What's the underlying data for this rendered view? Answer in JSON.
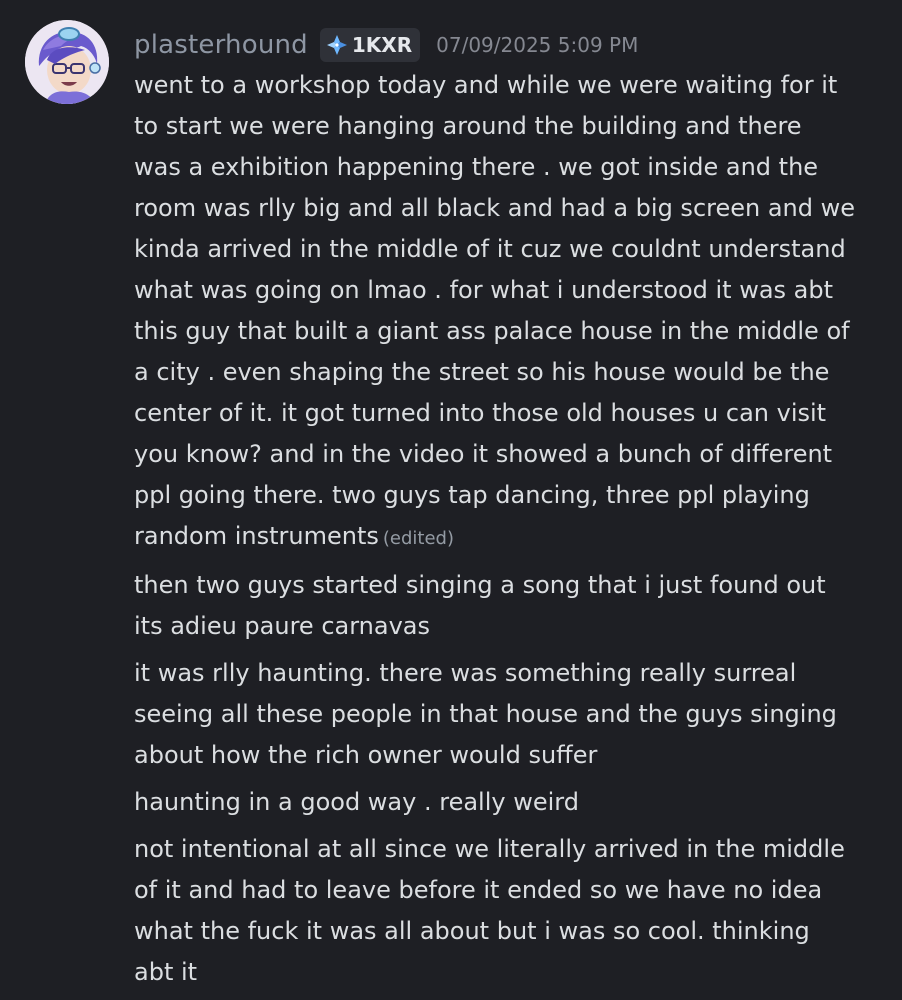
{
  "user": {
    "name": "plasterhound",
    "tag": "1KXR",
    "timestamp": "07/09/2025 5:09 PM"
  },
  "colors": {
    "background": "#1e1f24",
    "username": "#8e96a3",
    "text": "#dbdee1",
    "muted": "#858891"
  },
  "icons": {
    "avatar": "profile-picture",
    "tag": "diamond-badge-icon"
  },
  "messages": [
    {
      "lines": [
        "went to a workshop today and while we were waiting for it",
        "to start we were hanging around the building and there",
        "was a exhibition happening there . we got inside and the",
        "room was rlly big and all black and had a big screen and we",
        "kinda arrived in the middle of it cuz we couldnt understand",
        "what was going on lmao . for what i understood it was abt",
        "this guy that built a giant ass palace house in the middle of",
        "a city . even shaping the street so his house would be the",
        "center of it. it got turned into those old houses u can visit",
        "you know? and in the video it showed a bunch of different",
        "ppl going there. two guys tap dancing, three ppl playing",
        "random instruments"
      ],
      "edited": "(edited)"
    },
    {
      "lines": [
        "then two guys started singing a song that i just found out",
        "its adieu paure carnavas"
      ]
    },
    {
      "lines": [
        "it was rlly haunting. there was something really surreal",
        "seeing all these people in that house and the guys singing",
        "about how the rich owner would suffer"
      ]
    },
    {
      "lines": [
        "haunting in a good way . really weird"
      ]
    },
    {
      "lines": [
        "not intentional at all since we literally arrived in the middle",
        "of it and had to leave before it ended so we have no idea",
        "what the fuck it was all about but i was so cool. thinking",
        "abt it"
      ]
    }
  ]
}
